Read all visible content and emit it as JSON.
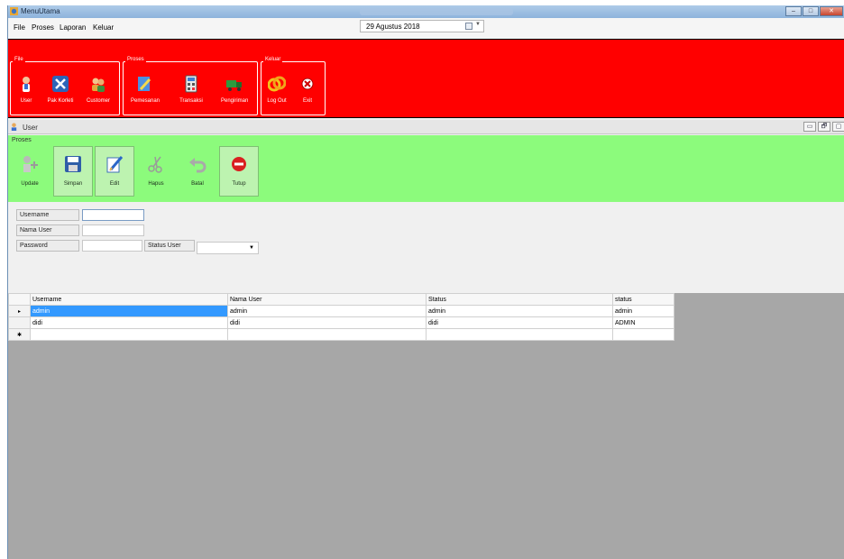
{
  "window": {
    "title": "MenuUtama",
    "controls": [
      "–",
      "□",
      "✕"
    ]
  },
  "menu": {
    "items": [
      "File",
      "Proses",
      "Laporan",
      "Keluar"
    ]
  },
  "date_picker": {
    "value": "29 Agustus 2018"
  },
  "main_toolbar": {
    "groups": [
      {
        "label": "File",
        "buttons": [
          {
            "label": "User",
            "icon": "user-icon"
          },
          {
            "label": "Pak Korleti",
            "icon": "tools-icon"
          },
          {
            "label": "Customer",
            "icon": "customers-icon"
          }
        ]
      },
      {
        "label": "Proses",
        "buttons": [
          {
            "label": "Pemesanan",
            "icon": "order-edit-icon"
          },
          {
            "label": "Transaksi",
            "icon": "calculator-icon"
          },
          {
            "label": "Pengiriman",
            "icon": "truck-icon"
          }
        ]
      },
      {
        "label": "Keluar",
        "buttons": [
          {
            "label": "Log Out",
            "icon": "logout-icon"
          },
          {
            "label": "Exit",
            "icon": "exit-icon"
          }
        ]
      }
    ]
  },
  "child_window": {
    "title": "User",
    "controls": [
      "▭",
      "🗗",
      "▢"
    ]
  },
  "proses_toolbar": {
    "label": "Proses",
    "buttons": [
      {
        "label": "Update",
        "icon": "add-user-icon",
        "selected": false
      },
      {
        "label": "Simpan",
        "icon": "save-icon",
        "selected": true
      },
      {
        "label": "Edit",
        "icon": "edit-icon",
        "selected": true
      },
      {
        "label": "Hapus",
        "icon": "scissors-icon",
        "selected": false
      },
      {
        "label": "Batal",
        "icon": "undo-icon",
        "selected": false
      },
      {
        "label": "Tutup",
        "icon": "stop-icon",
        "selected": true
      }
    ]
  },
  "form": {
    "username_label": "Username",
    "username_value": "",
    "nama_user_label": "Nama User",
    "nama_user_value": "",
    "password_label": "Password",
    "password_value": "",
    "status_user_label": "Status User",
    "status_user_value": ""
  },
  "grid": {
    "columns": [
      "Username",
      "Nama User",
      "Status",
      "status"
    ],
    "rows": [
      {
        "indicator": "▸",
        "cells": [
          "admin",
          "admin",
          "admin",
          "admin"
        ]
      },
      {
        "indicator": "",
        "cells": [
          "didi",
          "didi",
          "didi",
          "ADMIN"
        ]
      },
      {
        "indicator": "✱",
        "cells": [
          "",
          "",
          "",
          ""
        ]
      }
    ]
  }
}
